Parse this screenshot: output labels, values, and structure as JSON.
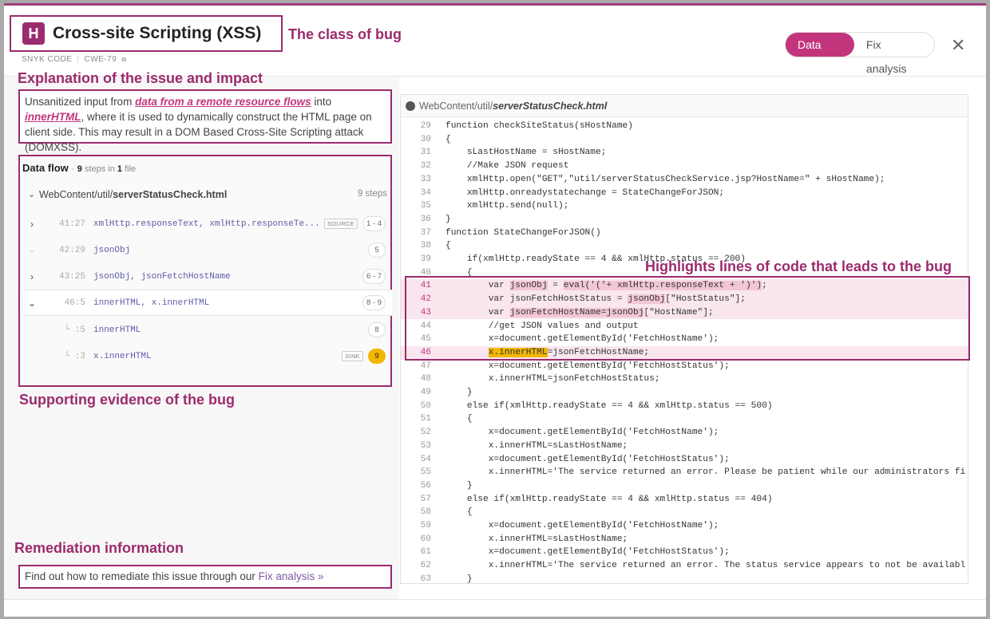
{
  "header": {
    "badge": "H",
    "title": "Cross-site Scripting (XSS)",
    "meta_source": "SNYK CODE",
    "meta_sep": "|",
    "meta_cwe": "CWE-79",
    "meta_cwe_icon": "external-link-icon",
    "tabs": [
      {
        "label": "Data flow",
        "active": true
      },
      {
        "label": "Fix analysis",
        "active": false
      }
    ],
    "close_glyph": "✕"
  },
  "annotations": {
    "class_of_bug": "The class of bug",
    "explanation": "Explanation of the issue and impact",
    "supporting": "Supporting evidence of the bug",
    "highlights": "Highlights lines of code that leads to the bug",
    "remediation": "Remediation information"
  },
  "explanation": {
    "pre": "Unsanitized input from ",
    "source": "data from a remote resource flows",
    "mid": " into ",
    "sink": "innerHTML",
    "post": ", where it is used to dynamically construct the HTML page on client side. This may result in a DOM Based Cross-Site Scripting attack (DOMXSS)."
  },
  "dataflow": {
    "title": "Data flow",
    "dot": "·",
    "steps_count": "9",
    "steps_word": "steps in",
    "file_count": "1",
    "file_word": "file",
    "file_dir": "WebContent/util/",
    "file_name": "serverStatusCheck.html",
    "file_steps": "9 steps",
    "steps": [
      {
        "arrow": "›",
        "pos": "41:27",
        "code": "xmlHttp.responseText, xmlHttp.responseTe...",
        "tag": "SOURCE",
        "num": "1 - 4"
      },
      {
        "arrow": "–",
        "pos": "42:29",
        "code": "jsonObj",
        "tag": "",
        "num": "5"
      },
      {
        "arrow": "›",
        "pos": "43:25",
        "code": "jsonObj, jsonFetchHostName",
        "tag": "",
        "num": "6 - 7"
      },
      {
        "arrow": "⌄",
        "pos": "46:5",
        "code": "innerHTML, x.innerHTML",
        "tag": "",
        "num": "8 - 9"
      },
      {
        "arrow": "",
        "pos": "└ :5",
        "code": "innerHTML",
        "tag": "",
        "num": "8"
      },
      {
        "arrow": "",
        "pos": "└ :3",
        "code": "x.innerHTML",
        "tag": "SINK",
        "num": "9"
      }
    ]
  },
  "remediation": {
    "text": "Find out how to remediate this issue through our ",
    "link": "Fix analysis »"
  },
  "code": {
    "file_dir": "WebContent/util/",
    "file_name": "serverStatusCheck.html",
    "lines": [
      {
        "n": "29",
        "t": "function checkSiteStatus(sHostName)"
      },
      {
        "n": "30",
        "t": "{"
      },
      {
        "n": "31",
        "t": "    sLastHostName = sHostName;"
      },
      {
        "n": "32",
        "t": "    //Make JSON request"
      },
      {
        "n": "33",
        "t": "    xmlHttp.open(\"GET\",\"util/serverStatusCheckService.jsp?HostName=\" + sHostName);"
      },
      {
        "n": "34",
        "t": "    xmlHttp.onreadystatechange = StateChangeForJSON;"
      },
      {
        "n": "35",
        "t": "    xmlHttp.send(null);"
      },
      {
        "n": "36",
        "t": "}"
      },
      {
        "n": "37",
        "t": "function StateChangeForJSON()"
      },
      {
        "n": "38",
        "t": "{"
      },
      {
        "n": "39",
        "t": "    if(xmlHttp.readyState == 4 && xmlHttp.status == 200)"
      },
      {
        "n": "40",
        "t": "    {"
      },
      {
        "n": "41",
        "t": "        var jsonObj = eval('('+ xmlHttp.responseText + ')');"
      },
      {
        "n": "42",
        "t": "        var jsonFetchHostStatus = jsonObj[\"HostStatus\"];"
      },
      {
        "n": "43",
        "t": "        var jsonFetchHostName=jsonObj[\"HostName\"];"
      },
      {
        "n": "44",
        "t": "        //get JSON values and output"
      },
      {
        "n": "45",
        "t": "        x=document.getElementById('FetchHostName');"
      },
      {
        "n": "46",
        "t": "        x.innerHTML=jsonFetchHostName;"
      },
      {
        "n": "47",
        "t": "        x=document.getElementById('FetchHostStatus');"
      },
      {
        "n": "48",
        "t": "        x.innerHTML=jsonFetchHostStatus;"
      },
      {
        "n": "49",
        "t": "    }"
      },
      {
        "n": "50",
        "t": "    else if(xmlHttp.readyState == 4 && xmlHttp.status == 500)"
      },
      {
        "n": "51",
        "t": "    {"
      },
      {
        "n": "52",
        "t": "        x=document.getElementById('FetchHostName');"
      },
      {
        "n": "53",
        "t": "        x.innerHTML=sLastHostName;"
      },
      {
        "n": "54",
        "t": "        x=document.getElementById('FetchHostStatus');"
      },
      {
        "n": "55",
        "t": "        x.innerHTML='The service returned an error. Please be patient while our administrators fi"
      },
      {
        "n": "56",
        "t": "    }"
      },
      {
        "n": "57",
        "t": "    else if(xmlHttp.readyState == 4 && xmlHttp.status == 404)"
      },
      {
        "n": "58",
        "t": "    {"
      },
      {
        "n": "59",
        "t": "        x=document.getElementById('FetchHostName');"
      },
      {
        "n": "60",
        "t": "        x.innerHTML=sLastHostName;"
      },
      {
        "n": "61",
        "t": "        x=document.getElementById('FetchHostStatus');"
      },
      {
        "n": "62",
        "t": "        x.innerHTML='The service returned an error. The status service appears to not be availabl"
      },
      {
        "n": "63",
        "t": "    }"
      }
    ],
    "highlighted_lines": [
      "41",
      "42",
      "43",
      "46"
    ]
  },
  "colors": {
    "brand": "#9b2b6e",
    "tab_active": "#c2357d",
    "sink": "#f2b800",
    "highlight_bg": "#f9e6ee"
  }
}
